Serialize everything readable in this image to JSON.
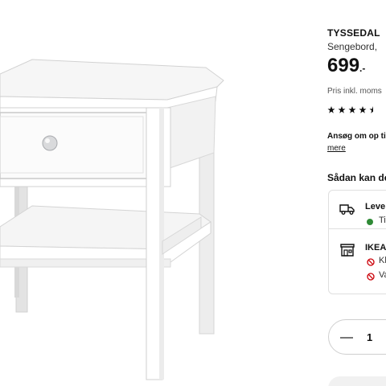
{
  "product": {
    "name": "TYSSEDAL",
    "description": "Sengebord,",
    "price_main": "699",
    "price_decimal": ".-",
    "price_info": "Pris inkl. moms",
    "rating": 4.5,
    "apply_text": "Ansøg om op ti",
    "more_link": "mere"
  },
  "delivery": {
    "heading": "Sådan kan de",
    "options": [
      {
        "title": "Leve",
        "status": "Ti",
        "status_color": "#2f8a36"
      },
      {
        "title": "IKEA",
        "statuses": [
          "Kl",
          "Va"
        ],
        "status_color": "#cc0008"
      }
    ]
  },
  "quantity": {
    "value": "1"
  },
  "colors": {
    "text": "#111111",
    "available": "#2f8a36",
    "unavailable": "#cc0008",
    "border": "#dfdfdf"
  }
}
